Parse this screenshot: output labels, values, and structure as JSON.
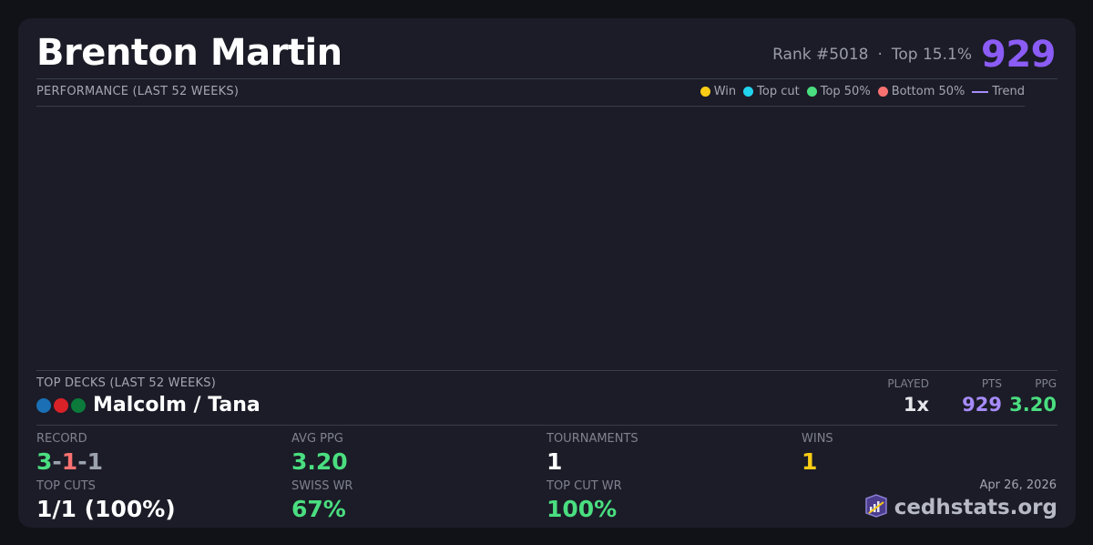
{
  "header": {
    "player_name": "Brenton Martin",
    "rank": "Rank #5018",
    "separator": "·",
    "top_percent": "Top 15.1%",
    "rating": "929"
  },
  "performance": {
    "label": "PERFORMANCE (LAST 52 WEEKS)",
    "legend": [
      {
        "label": "Win",
        "color": "#facc15",
        "kind": "dot"
      },
      {
        "label": "Top cut",
        "color": "#22d3ee",
        "kind": "dot"
      },
      {
        "label": "Top 50%",
        "color": "#4ade80",
        "kind": "dot"
      },
      {
        "label": "Bottom 50%",
        "color": "#f87171",
        "kind": "dot"
      },
      {
        "label": "Trend",
        "color": "#a78bfa",
        "kind": "line"
      }
    ]
  },
  "top_decks": {
    "label": "TOP DECKS (LAST 52 WEEKS)",
    "columns": {
      "played": "PLAYED",
      "pts": "PTS",
      "ppg": "PPG"
    },
    "deck": {
      "name": "Malcolm / Tana",
      "colors": [
        "#1a6fb5",
        "#d92128",
        "#0b7a3b"
      ],
      "played": "1x",
      "pts": "929",
      "ppg": "3.20"
    }
  },
  "stats": {
    "record_label": "RECORD",
    "record_wins": "3",
    "record_losses": "1",
    "record_draws": "1",
    "record_sep": "-",
    "avg_ppg_label": "AVG PPG",
    "avg_ppg": "3.20",
    "tournaments_label": "TOURNAMENTS",
    "tournaments": "1",
    "wins_label": "WINS",
    "wins": "1",
    "top_cuts_label": "TOP CUTS",
    "top_cuts": "1/1 (100%)",
    "swiss_wr_label": "SWISS WR",
    "swiss_wr": "67%",
    "top_cut_wr_label": "TOP CUT WR",
    "top_cut_wr": "100%"
  },
  "footer": {
    "date": "Apr 26, 2026",
    "site": "cedhstats.org",
    "logo_icon": "cedhstats-logo-icon"
  },
  "colors": {
    "accent": "#8b5cf6",
    "green": "#4ade80",
    "red": "#f87171",
    "gray": "#9ca3af",
    "yellow": "#facc15",
    "pts": "#a78bfa"
  }
}
